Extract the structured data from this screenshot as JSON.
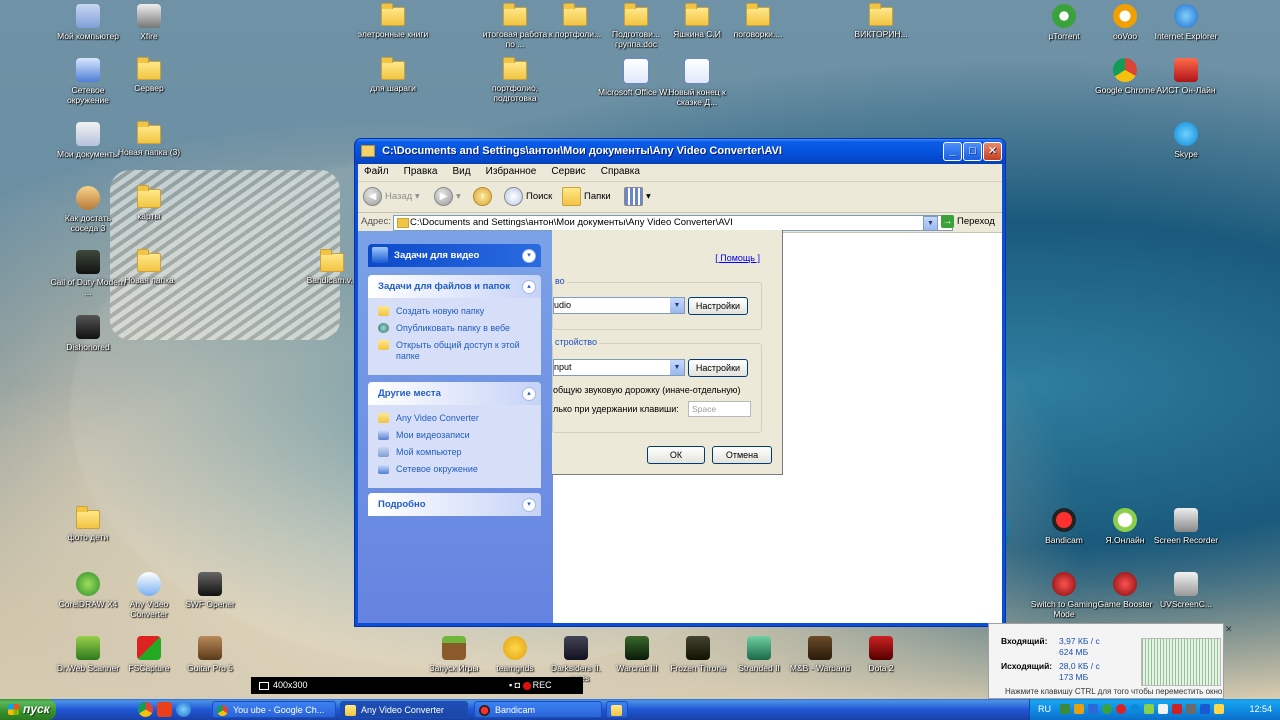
{
  "desktop_icons": [
    {
      "label": "Мой компьютер",
      "icon": "computer-icon"
    },
    {
      "label": "Xfire",
      "icon": "xfire-icon"
    },
    {
      "label": "элетронные книги",
      "icon": "folder-icon"
    },
    {
      "label": "итоговая работа по ...",
      "icon": "folder-icon"
    },
    {
      "label": "к портфоли...",
      "icon": "folder-icon"
    },
    {
      "label": "Подготови... группа.doc",
      "icon": "folder-icon"
    },
    {
      "label": "Яшкина С.И",
      "icon": "folder-icon"
    },
    {
      "label": "поговорки....",
      "icon": "folder-icon"
    },
    {
      "label": "ВИКТОРИН...",
      "icon": "folder-icon"
    },
    {
      "label": "µTorrent",
      "icon": "utorrent-icon"
    },
    {
      "label": "ooVoo",
      "icon": "oovoo-icon"
    },
    {
      "label": "Internet Explorer",
      "icon": "ie-icon"
    },
    {
      "label": "Сетевое окружение",
      "icon": "network-icon"
    },
    {
      "label": "Сервер",
      "icon": "folder-icon"
    },
    {
      "label": "для шараги",
      "icon": "folder-icon"
    },
    {
      "label": "портфолио, подготовка",
      "icon": "folder-icon"
    },
    {
      "label": "Microsoft Office W...",
      "icon": "word-doc-icon"
    },
    {
      "label": "Новый конец к сказке Д...",
      "icon": "word-doc-icon"
    },
    {
      "label": "Google Chrome",
      "icon": "chrome-icon"
    },
    {
      "label": "АИСТ Он-Лайн",
      "icon": "aist-icon"
    },
    {
      "label": "Мои документы",
      "icon": "documents-icon"
    },
    {
      "label": "Новая папка (3)",
      "icon": "folder-icon"
    },
    {
      "label": "Skype",
      "icon": "skype-icon"
    },
    {
      "label": "Как достать соседа 3",
      "icon": "game-icon"
    },
    {
      "label": "карты",
      "icon": "folder-icon"
    },
    {
      "label": "Call of Duty Modern ...",
      "icon": "game-icon"
    },
    {
      "label": "Новая папка",
      "icon": "folder-icon"
    },
    {
      "label": "Bandicam.v...",
      "icon": "folder-icon"
    },
    {
      "label": "Dishonored",
      "icon": "game-icon"
    },
    {
      "label": "фото дети",
      "icon": "folder-icon"
    },
    {
      "label": "Bandicam",
      "icon": "bandicam-icon"
    },
    {
      "label": "Я.Онлайн",
      "icon": "ya-online-icon"
    },
    {
      "label": "Screen Recorder",
      "icon": "screen-recorder-icon"
    },
    {
      "label": "CorelDRAW X4",
      "icon": "coreldraw-icon"
    },
    {
      "label": "Any Video Converter",
      "icon": "any-video-converter-icon"
    },
    {
      "label": "SWF Opener",
      "icon": "swf-icon"
    },
    {
      "label": "Switch to Gaming Mode",
      "icon": "gaming-mode-icon"
    },
    {
      "label": "Game Booster",
      "icon": "game-booster-icon"
    },
    {
      "label": "UVScreenC...",
      "icon": "uvscreen-icon"
    },
    {
      "label": "Dr.Web Scanner",
      "icon": "drweb-icon"
    },
    {
      "label": "FSCapture",
      "icon": "fscapture-icon"
    },
    {
      "label": "Guitar Pro 5",
      "icon": "guitarpro-icon"
    },
    {
      "label": "Запуск Игры",
      "icon": "minecraft-icon"
    },
    {
      "label": "teamgrids",
      "icon": "smiley-icon"
    },
    {
      "label": "Darksiders II. ...wyes",
      "icon": "game-icon"
    },
    {
      "label": "Warcraft III",
      "icon": "game-icon"
    },
    {
      "label": "Frozen Throne",
      "icon": "game-icon"
    },
    {
      "label": "Stranded II",
      "icon": "game-icon"
    },
    {
      "label": "M&B - Warband",
      "icon": "game-icon"
    },
    {
      "label": "Dota 2",
      "icon": "game-icon"
    }
  ],
  "explorer": {
    "title": "C:\\Documents and Settings\\антон\\Мои документы\\Any Video Converter\\AVI",
    "menu": [
      "Файл",
      "Правка",
      "Вид",
      "Избранное",
      "Сервис",
      "Справка"
    ],
    "toolbar": {
      "back": "Назад",
      "search": "Поиск",
      "folders": "Папки"
    },
    "address": {
      "label": "Адрес:",
      "value": "C:\\Documents and Settings\\антон\\Мои документы\\Any Video Converter\\AVI",
      "go": "Переход"
    },
    "panels": {
      "video_tasks": {
        "title": "Задачи для видео"
      },
      "file_tasks": {
        "title": "Задачи для файлов и папок",
        "items": [
          "Создать новую папку",
          "Опубликовать папку в вебе",
          "Открыть общий доступ к этой папке"
        ]
      },
      "other_places": {
        "title": "Другие места",
        "items": [
          "Any Video Converter",
          "Мои видеозаписи",
          "Мой компьютер",
          "Сетевое окружение"
        ]
      },
      "details": {
        "title": "Подробно"
      }
    }
  },
  "dialog": {
    "help_link": "[ Помощь ]",
    "group1_label": "во",
    "combo1_value": "udio",
    "settings1": "Настройки",
    "group2_label": "стройство",
    "combo2_value": "nput",
    "settings2": "Настройки",
    "check1": "общую звуковую дорожку (иначе-отдельную)",
    "check2": "лько при удержании клавиши:",
    "key_value": "Space",
    "ok": "ОК",
    "cancel": "Отмена"
  },
  "recorder": {
    "resolution": "400x300",
    "rec": "REC"
  },
  "netmeter": {
    "in_label": "Входящий:",
    "in_rate": "3,97 КБ / с",
    "in_total": "624 МБ",
    "out_label": "Исходящий:",
    "out_rate": "28,0 КБ / с",
    "out_total": "173 МБ",
    "hint": "Нажмите клавишу CTRL для того чтобы переместить окно"
  },
  "taskbar": {
    "start": "пуск",
    "tasks": [
      {
        "label": "You ube - Google Ch...",
        "icon": "chrome-icon"
      },
      {
        "label": "Any Video Converter",
        "icon": "folder-window-icon"
      },
      {
        "label": "Bandicam",
        "icon": "bandicam-icon"
      }
    ],
    "lang": "RU",
    "clock": "12:54"
  }
}
